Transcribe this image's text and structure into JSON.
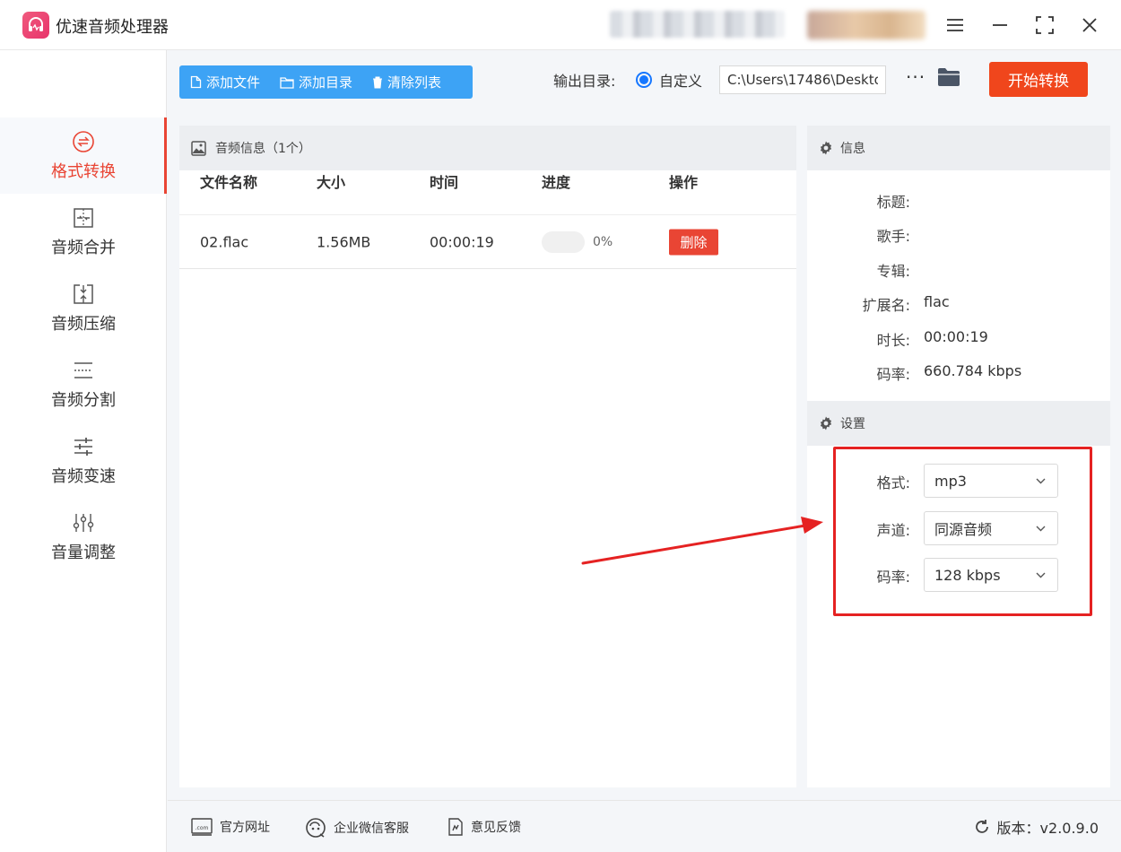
{
  "app": {
    "title": "优速音频处理器"
  },
  "sidebar": {
    "items": [
      {
        "label": "格式转换",
        "icon": "format-convert-icon",
        "active": true
      },
      {
        "label": "音频合并",
        "icon": "merge-icon"
      },
      {
        "label": "音频压缩",
        "icon": "compress-icon"
      },
      {
        "label": "音频分割",
        "icon": "split-icon"
      },
      {
        "label": "音频变速",
        "icon": "speed-icon"
      },
      {
        "label": "音量调整",
        "icon": "volume-adjust-icon"
      }
    ]
  },
  "toolbar": {
    "add_file": "添加文件",
    "add_dir": "添加目录",
    "clear_list": "清除列表",
    "output_label": "输出目录:",
    "custom_label": "自定义",
    "output_path": "C:\\Users\\17486\\Deskto",
    "more": "···",
    "start": "开始转换"
  },
  "file_list": {
    "header": "音频信息（1个）",
    "columns": [
      "文件名称",
      "大小",
      "时间",
      "进度",
      "操作"
    ],
    "rows": [
      {
        "name": "02.flac",
        "size": "1.56MB",
        "time": "00:00:19",
        "progress_text": "0%",
        "progress": 0,
        "action": "删除"
      }
    ]
  },
  "info": {
    "header": "信息",
    "fields": [
      {
        "label": "标题:",
        "value": ""
      },
      {
        "label": "歌手:",
        "value": ""
      },
      {
        "label": "专辑:",
        "value": ""
      },
      {
        "label": "扩展名:",
        "value": "flac"
      },
      {
        "label": "时长:",
        "value": "00:00:19"
      },
      {
        "label": "码率:",
        "value": "660.784 kbps"
      }
    ]
  },
  "settings": {
    "header": "设置",
    "fields": [
      {
        "label": "格式:",
        "value": "mp3"
      },
      {
        "label": "声道:",
        "value": "同源音频"
      },
      {
        "label": "码率:",
        "value": "128 kbps"
      }
    ]
  },
  "footer": {
    "website": "官方网址",
    "wechat": "企业微信客服",
    "feedback": "意见反馈",
    "version": "版本：v2.0.9.0"
  },
  "colors": {
    "accent_red": "#e94534",
    "start_button": "#f0461c",
    "toolbar_blue": "#3da3f5",
    "radio_blue": "#1677ff",
    "annotation_red": "#e52222"
  }
}
